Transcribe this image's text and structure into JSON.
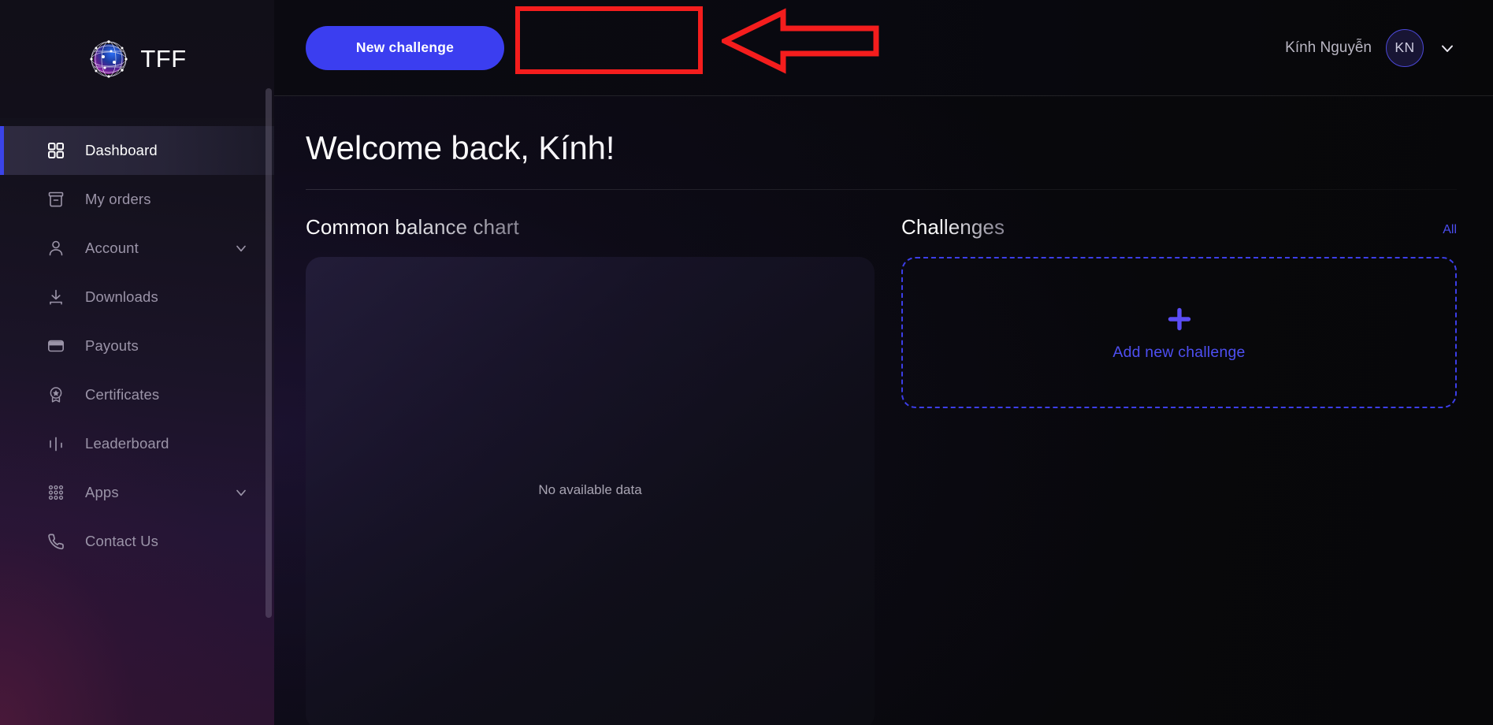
{
  "brand": {
    "name": "TFF",
    "logo_icon": "globe-wireframe-icon"
  },
  "sidebar": {
    "items": [
      {
        "label": "Dashboard",
        "icon": "grid-squares-icon",
        "active": true,
        "expandable": false
      },
      {
        "label": "My orders",
        "icon": "box-archive-icon",
        "active": false,
        "expandable": false
      },
      {
        "label": "Account",
        "icon": "user-icon",
        "active": false,
        "expandable": true
      },
      {
        "label": "Downloads",
        "icon": "download-icon",
        "active": false,
        "expandable": false
      },
      {
        "label": "Payouts",
        "icon": "wallet-icon",
        "active": false,
        "expandable": false
      },
      {
        "label": "Certificates",
        "icon": "award-badge-icon",
        "active": false,
        "expandable": false
      },
      {
        "label": "Leaderboard",
        "icon": "bar-chart-icon",
        "active": false,
        "expandable": false
      },
      {
        "label": "Apps",
        "icon": "dots-grid-icon",
        "active": false,
        "expandable": true
      },
      {
        "label": "Contact Us",
        "icon": "phone-icon",
        "active": false,
        "expandable": false
      }
    ]
  },
  "topbar": {
    "new_challenge_label": "New challenge",
    "user_name": "Kính Nguyễn",
    "user_initials": "KN",
    "chevron_icon": "chevron-down-icon"
  },
  "main": {
    "welcome_heading": "Welcome back, Kính!",
    "balance_section": {
      "title": "Common balance chart",
      "title_strong": "Common balance",
      "title_muted": "chart",
      "empty_message": "No available data"
    },
    "challenges_section": {
      "title": "Challenges",
      "all_label": "All",
      "add_label": "Add new challenge",
      "plus_icon": "plus-icon"
    }
  },
  "annotations": {
    "highlight_color": "#f41d1d",
    "highlight_target": "New challenge",
    "arrow_icon": "left-arrow-annotation"
  },
  "colors": {
    "accent_blue": "#3b3ef0",
    "link_indigo": "#4b4df0",
    "dashed_border": "#3c3ee8",
    "annotation_red": "#f41d1d",
    "sidebar_active_bar": "#3b44e8"
  }
}
